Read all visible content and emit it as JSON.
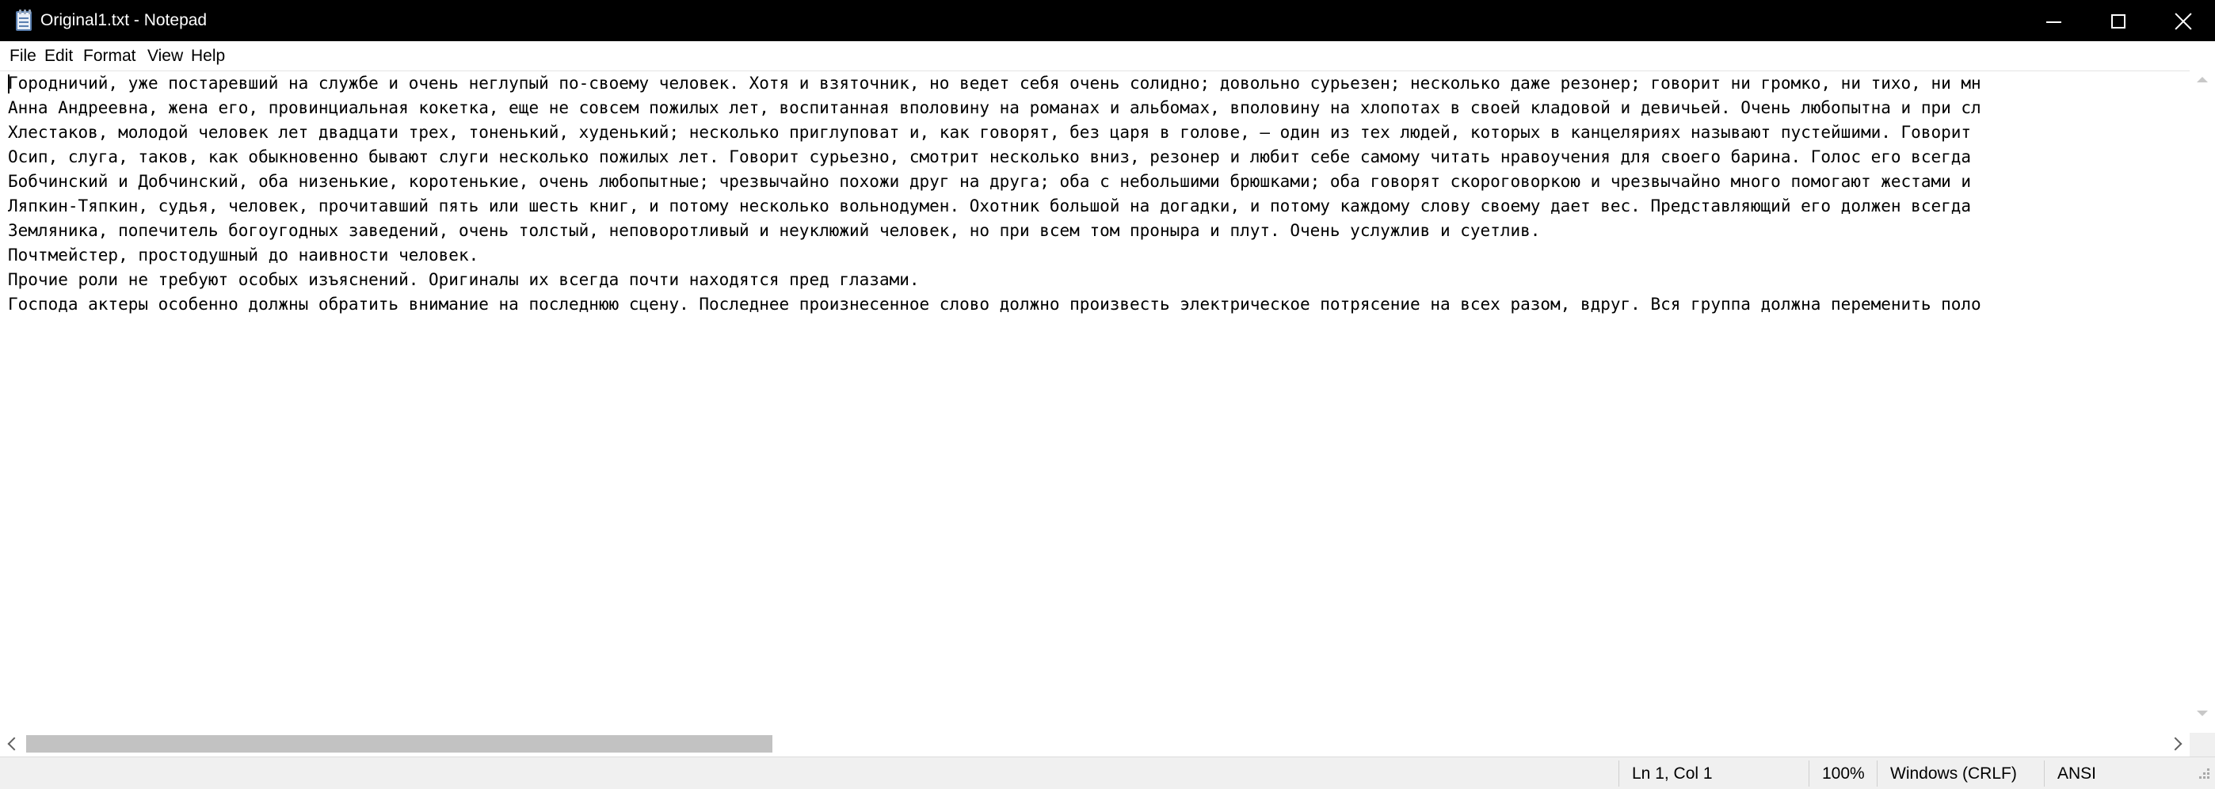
{
  "window": {
    "title": "Original1.txt - Notepad",
    "minimize_icon": "minimize-icon",
    "maximize_icon": "maximize-icon",
    "close_icon": "close-icon",
    "app_icon": "notepad-icon"
  },
  "menu": {
    "items": [
      {
        "label": "File"
      },
      {
        "label": "Edit"
      },
      {
        "label": "Format"
      },
      {
        "label": "View"
      },
      {
        "label": "Help"
      }
    ]
  },
  "document": {
    "lines": [
      "Городничий, уже постаревший на службе и очень неглупый по-своему человек. Хотя и взяточник, но ведет себя очень солидно; довольно сурьезен; несколько даже резонер; говорит ни громко, ни тихо, ни мн",
      "Анна Андреевна, жена его, провинциальная кокетка, еще не совсем пожилых лет, воспитанная вполовину на романах и альбомах, вполовину на хлопотах в своей кладовой и девичьей. Очень любопытна и при сл",
      "Хлестаков, молодой человек лет двадцати трех, тоненький, худенький; несколько приглуповат и, как говорят, без царя в голове, — один из тех людей, которых в канцеляриях называют пустейшими. Говорит",
      "Осип, слуга, таков, как обыкновенно бывают слуги несколько пожилых лет. Говорит сурьезно, смотрит несколько вниз, резонер и любит себе самому читать нравоучения для своего барина. Голос его всегда",
      "Бобчинский и Добчинский, оба низенькие, коротенькие, очень любопытные; чрезвычайно похожи друг на друга; оба с небольшими брюшками; оба говорят скороговоркою и чрезвычайно много помогают жестами и",
      "Ляпкин-Тяпкин, судья, человек, прочитавший пять или шесть книг, и потому несколько вольнодумен. Охотник большой на догадки, и потому каждому слову своему дает вес. Представляющий его должен всегда",
      "Земляника, попечитель богоугодных заведений, очень толстый, неповоротливый и неуклюжий человек, но при всем том проныра и плут. Очень услужлив и суетлив.",
      "Почтмейстер, простодушный до наивности человек.",
      "Прочие роли не требуют особых изъяснений. Оригиналы их всегда почти находятся пред глазами.",
      "Господа актеры особенно должны обратить внимание на последнюю сцену. Последнее произнесенное слово должно произвесть электрическое потрясение на всех разом, вдруг. Вся группа должна переменить поло"
    ]
  },
  "scrollbars": {
    "left_arrow_icon": "chevron-left-icon",
    "right_arrow_icon": "chevron-right-icon",
    "up_arrow_icon": "chevron-up-icon",
    "down_arrow_icon": "chevron-down-icon"
  },
  "status": {
    "position": "Ln 1, Col 1",
    "zoom": "100%",
    "line_ending": "Windows (CRLF)",
    "encoding": "ANSI"
  },
  "colors": {
    "titlebar_bg": "#000000",
    "titlebar_text": "#ffffff",
    "statusbar_bg": "#f0f0f0",
    "text": "#000000"
  }
}
